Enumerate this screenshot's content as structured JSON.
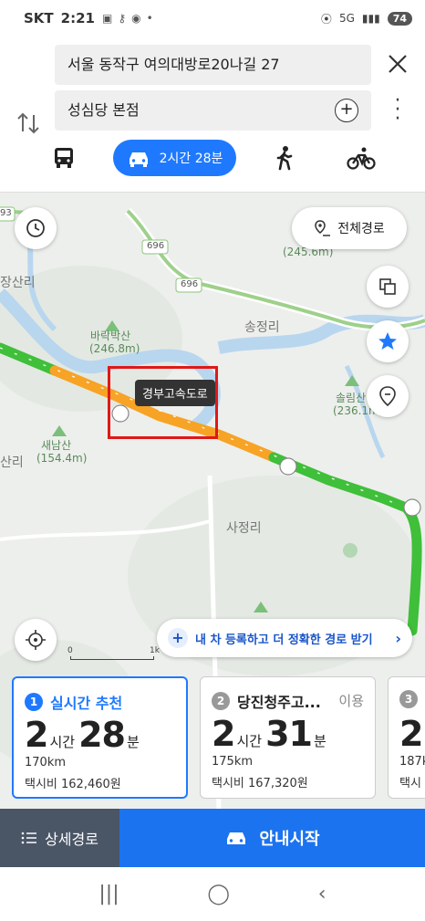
{
  "status_bar": {
    "carrier": "SKT",
    "time": "2:21",
    "network": "5G",
    "battery": "74"
  },
  "search": {
    "origin": "서울 동작구 여의대방로20나길 27",
    "destination": "성심당 본점"
  },
  "modes": {
    "car_duration": "2시간 28분"
  },
  "map": {
    "full_route_label": "전체경로",
    "tooltip": "경부고속도로",
    "register_banner": "내 차 등록하고 더 정확한 경로 받기",
    "scale_start": "0",
    "scale_end": "1k",
    "labels": {
      "mountain1": "바락박산",
      "mountain1_height": "(246.8m)",
      "mountain2": "새남산",
      "mountain2_height": "(154.4m)",
      "mountain3": "솔림산",
      "mountain3_height": "(236.1m)",
      "mountain4_height": "(245.6m)",
      "village1": "송정리",
      "village2": "사정리",
      "village3": "장산리",
      "village4": "산리",
      "road1": "696",
      "road2": "696",
      "road_edge": "93"
    }
  },
  "routes": [
    {
      "index": "1",
      "title": "실시간 추천",
      "tag": "",
      "hours": "2",
      "hours_unit": "시간",
      "minutes": "28",
      "minutes_unit": "분",
      "distance": "170km",
      "fare": "택시비 162,460원"
    },
    {
      "index": "2",
      "title": "당진청주고...",
      "tag": "이용",
      "hours": "2",
      "hours_unit": "시간",
      "minutes": "31",
      "minutes_unit": "분",
      "distance": "175km",
      "fare": "택시비 167,320원"
    },
    {
      "index": "3",
      "title": "",
      "tag": "",
      "hours": "2",
      "hours_unit": "",
      "minutes": "",
      "minutes_unit": "",
      "distance": "187k",
      "fare": "택시"
    }
  ],
  "actions": {
    "detail_route": "상세경로",
    "start_navigation": "안내시작"
  },
  "colors": {
    "accent": "#1f79ff",
    "route_orange": "#f7a325",
    "route_green": "#3fbf3a",
    "start_button": "#1b73ef",
    "detail_button": "#4a5566"
  }
}
